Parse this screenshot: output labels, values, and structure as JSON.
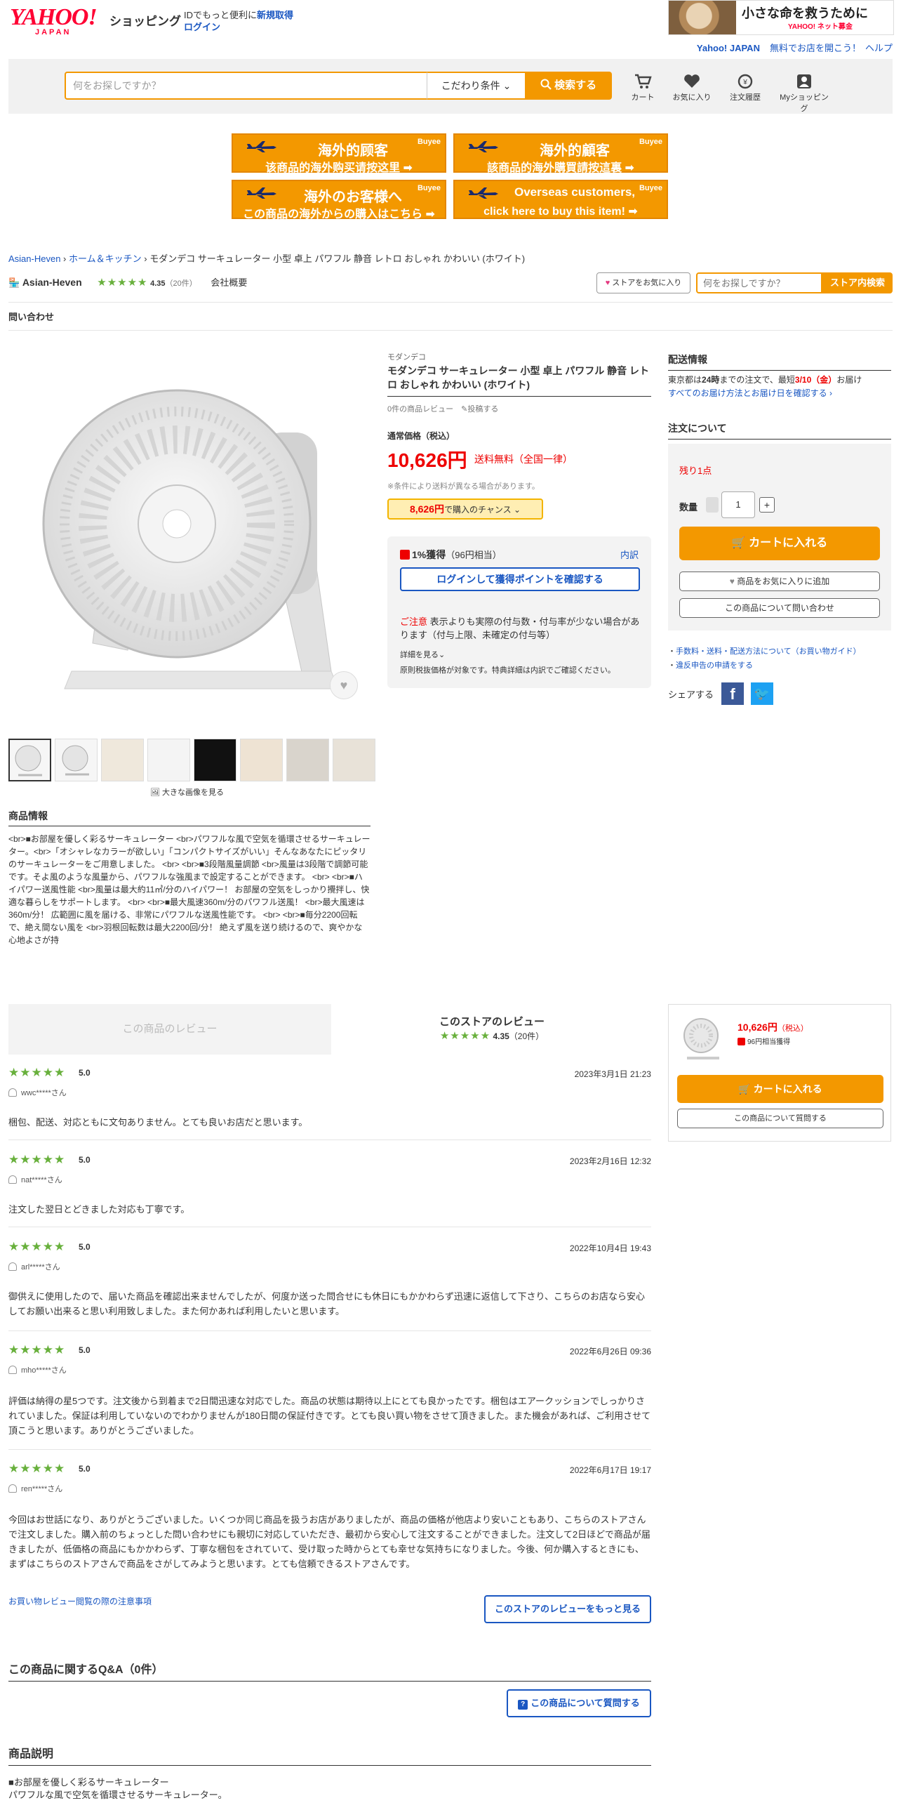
{
  "header": {
    "logo_yahoo": "YAHOO!",
    "logo_japan": "JAPAN",
    "logo_shopping": "ショッピング",
    "message_prefix": "IDでもっと便利に",
    "message_link": "新規取得",
    "login": "ログイン",
    "ad_text": "小さな命を救うために",
    "ad_sub": "YAHOO! ネット募金",
    "link_yahoo": "Yahoo! JAPAN",
    "link_open_store": "無料でお店を開こう！",
    "link_help": "ヘルプ"
  },
  "search": {
    "placeholder": "何をお探しですか？",
    "condition_label": "こだわり条件",
    "button_label": "検索する"
  },
  "nav": {
    "cart": "カート",
    "favorites": "お気に入り",
    "history": "注文履歴",
    "my_shopping": "Myショッピング"
  },
  "banners": [
    {
      "line1": "海外的顾客",
      "line2": "该商品的海外购买请按这里 ➡",
      "brand": "Buyee"
    },
    {
      "line1": "海外的顧客",
      "line2": "該商品的海外購買請按這裏 ➡",
      "brand": "Buyee"
    },
    {
      "line1": "海外のお客様へ",
      "line2": "この商品の海外からの購入はこちら ➡",
      "brand": "Buyee"
    },
    {
      "line1": "Overseas customers,",
      "line2": "click here to buy this item! ➡",
      "brand": "Buyee"
    }
  ],
  "breadcrumb": {
    "store": "Asian-Heven",
    "category": "ホーム＆キッチン",
    "current": "モダンデコ サーキュレーター 小型 卓上 パワフル 静音 レトロ おしゃれ かわいい (ホワイト)"
  },
  "store": {
    "name": "Asian-Heven",
    "stars": "★★★★★",
    "rating": "4.35",
    "review_count": "（20件）",
    "company": "会社概要",
    "fav_button": "ストアをお気に入り",
    "search_placeholder": "何をお探しですか？",
    "search_button": "ストア内検索",
    "inquiry_tab": "問い合わせ"
  },
  "gallery": {
    "big_image_link": "大きな画像を見る",
    "thumbnail_count": 8
  },
  "product": {
    "brand": "モダンデコ",
    "title": "モダンデコ サーキュレーター 小型 卓上 パワフル 静音 レトロ おしゃれ かわいい (ホワイト)",
    "review_summary": "0件の商品レビュー",
    "post_review": "投稿する",
    "price_label": "通常価格（税込）",
    "price": "10,626円",
    "shipping": "送料無料（全国一律）",
    "shipping_note": "※条件により送料が異なる場合があります。",
    "chance_price": "8,626円",
    "chance_text": "で購入のチャンス"
  },
  "points": {
    "rate": "1%獲得",
    "amount": "（96円相当）",
    "detail": "内訳",
    "login_button": "ログインして獲得ポイントを確認する",
    "caution_label": "ご注意",
    "caution_text": "表示よりも実際の付与数・付与率が少ない場合があります（付与上限、未確定の付与等）",
    "more": "詳細を見る",
    "original": "原則税抜価格が対象です。特典詳細は内訳でご確認ください。"
  },
  "delivery": {
    "heading": "配送情報",
    "text_prefix": "東京都は",
    "text_bold": "24時",
    "text_mid": "までの注文で、最短",
    "text_date": "3/10（金）",
    "text_suffix": "お届け",
    "link": "すべてのお届け方法とお届け日を確認する"
  },
  "order": {
    "heading": "注文について",
    "stock": "残り1点",
    "qty_label": "数量",
    "qty_value": "1",
    "cart_button": "カートに入れる",
    "fav_button": "商品をお気に入りに追加",
    "inquiry_button": "この商品について問い合わせ",
    "link_fees": "手数料・送料・配送方法について（お買い物ガイド）",
    "link_report": "違反申告の申請をする",
    "share": "シェアする"
  },
  "product_info": {
    "heading": "商品情報",
    "text": "<br>■お部屋を優しく彩るサーキュレーター <br>パワフルな風で空気を循環させるサーキュレーター。<br>「オシャレなカラーが欲しい」「コンパクトサイズがいい」そんなあなたにピッタリのサーキュレーターをご用意しました。 <br> <br>■3段階風量調節 <br>風量は3段階で調節可能です。そよ風のような風量から、パワフルな強風まで設定することができます。 <br> <br>■ハイパワー送風性能 <br>風量は最大約11㎥/分のハイパワー！ お部屋の空気をしっかり攪拌し、快適な暮らしをサポートします。 <br> <br>■最大風速360m/分のパワフル送風！ <br>最大風速は360m/分！ 広範囲に風を届ける、非常にパワフルな送風性能です。 <br> <br>■毎分2200回転で、絶え間ない風を <br>羽根回転数は最大2200回/分！ 絶えず風を送り続けるので、爽やかな心地よさが持"
  },
  "reviews": {
    "product_tab": "この商品のレビュー",
    "store_tab": "このストアのレビュー",
    "store_stars": "★★★★★",
    "store_rating": "4.35",
    "store_count": "（20件）",
    "items": [
      {
        "stars": "★★★★★",
        "score": "5.0",
        "date": "2023年3月1日 21:23",
        "user": "wwc*****さん",
        "body": "梱包、配送、対応ともに文句ありません。とても良いお店だと思います。"
      },
      {
        "stars": "★★★★★",
        "score": "5.0",
        "date": "2023年2月16日 12:32",
        "user": "nat*****さん",
        "body": "注文した翌日とどきました対応も丁寧です。"
      },
      {
        "stars": "★★★★★",
        "score": "5.0",
        "date": "2022年10月4日 19:43",
        "user": "arl*****さん",
        "body": "御供えに使用したので、届いた商品を確認出来ませんでしたが、何度か送った問合せにも休日にもかかわらず迅速に返信して下さり、こちらのお店なら安心してお願い出来ると思い利用致しました。また何かあれば利用したいと思います。"
      },
      {
        "stars": "★★★★★",
        "score": "5.0",
        "date": "2022年6月26日 09:36",
        "user": "mho*****さん",
        "body": "評価は納得の星5つです。注文後から到着まで2日間迅速な対応でした。商品の状態は期待以上にとても良かったです。梱包はエアークッションでしっかりされていました。保証は利用していないのでわかりませんが180日間の保証付きです。とても良い買い物をさせて頂きました。また機会があれば、ご利用させて頂こうと思います。ありがとうございました。"
      },
      {
        "stars": "★★★★★",
        "score": "5.0",
        "date": "2022年6月17日 19:17",
        "user": "ren*****さん",
        "body": "今回はお世話になり、ありがとうございました。いくつか同じ商品を扱うお店がありましたが、商品の価格が他店より安いこともあり、こちらのストアさんで注文しました。購入前のちょっとした問い合わせにも親切に対応していただき、最初から安心して注文することができました。注文して2日ほどで商品が届きましたが、低価格の商品にもかかわらず、丁寧な梱包をされていて、受け取った時からとても幸せな気持ちになりました。今後、何か購入するときにも、まずはこちらのストアさんで商品をさがしてみようと思います。とても信頼できるストアさんです。"
      }
    ],
    "note_link": "お買い物レビュー閲覧の際の注意事項",
    "more_button": "このストアのレビューをもっと見る"
  },
  "sticky": {
    "price": "10,626円",
    "tax": "（税込）",
    "points": "96円相当獲得",
    "cart_button": "カートに入れる",
    "question_button": "この商品について質問する"
  },
  "qa": {
    "heading": "この商品に関するQ&A（0件）",
    "button": "この商品について質問する"
  },
  "description": {
    "heading": "商品説明",
    "line1": "■お部屋を優しく彩るサーキュレーター",
    "line2": "パワフルな風で空気を循環させるサーキュレーター。"
  }
}
